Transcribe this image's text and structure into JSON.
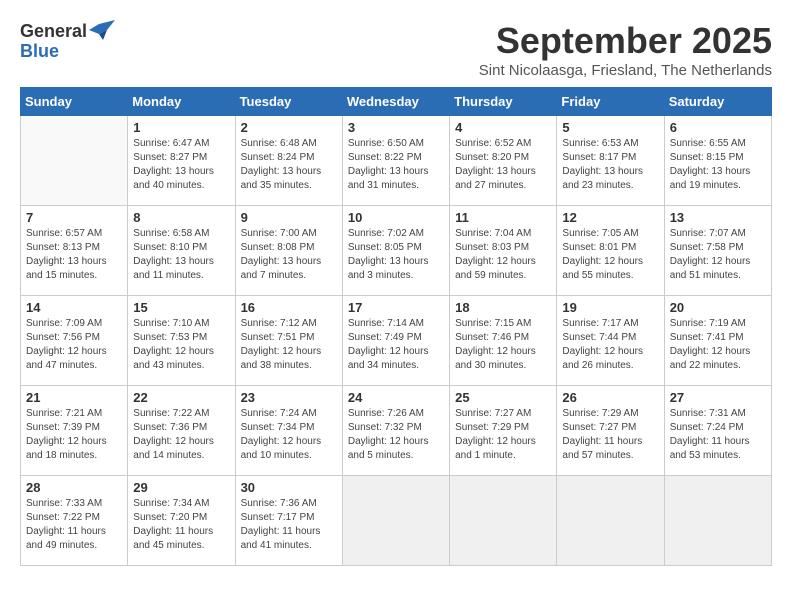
{
  "logo": {
    "general": "General",
    "blue": "Blue"
  },
  "title": "September 2025",
  "subtitle": "Sint Nicolaasga, Friesland, The Netherlands",
  "days_of_week": [
    "Sunday",
    "Monday",
    "Tuesday",
    "Wednesday",
    "Thursday",
    "Friday",
    "Saturday"
  ],
  "weeks": [
    [
      {
        "day": "",
        "info": ""
      },
      {
        "day": "1",
        "info": "Sunrise: 6:47 AM\nSunset: 8:27 PM\nDaylight: 13 hours and 40 minutes."
      },
      {
        "day": "2",
        "info": "Sunrise: 6:48 AM\nSunset: 8:24 PM\nDaylight: 13 hours and 35 minutes."
      },
      {
        "day": "3",
        "info": "Sunrise: 6:50 AM\nSunset: 8:22 PM\nDaylight: 13 hours and 31 minutes."
      },
      {
        "day": "4",
        "info": "Sunrise: 6:52 AM\nSunset: 8:20 PM\nDaylight: 13 hours and 27 minutes."
      },
      {
        "day": "5",
        "info": "Sunrise: 6:53 AM\nSunset: 8:17 PM\nDaylight: 13 hours and 23 minutes."
      },
      {
        "day": "6",
        "info": "Sunrise: 6:55 AM\nSunset: 8:15 PM\nDaylight: 13 hours and 19 minutes."
      }
    ],
    [
      {
        "day": "7",
        "info": "Sunrise: 6:57 AM\nSunset: 8:13 PM\nDaylight: 13 hours and 15 minutes."
      },
      {
        "day": "8",
        "info": "Sunrise: 6:58 AM\nSunset: 8:10 PM\nDaylight: 13 hours and 11 minutes."
      },
      {
        "day": "9",
        "info": "Sunrise: 7:00 AM\nSunset: 8:08 PM\nDaylight: 13 hours and 7 minutes."
      },
      {
        "day": "10",
        "info": "Sunrise: 7:02 AM\nSunset: 8:05 PM\nDaylight: 13 hours and 3 minutes."
      },
      {
        "day": "11",
        "info": "Sunrise: 7:04 AM\nSunset: 8:03 PM\nDaylight: 12 hours and 59 minutes."
      },
      {
        "day": "12",
        "info": "Sunrise: 7:05 AM\nSunset: 8:01 PM\nDaylight: 12 hours and 55 minutes."
      },
      {
        "day": "13",
        "info": "Sunrise: 7:07 AM\nSunset: 7:58 PM\nDaylight: 12 hours and 51 minutes."
      }
    ],
    [
      {
        "day": "14",
        "info": "Sunrise: 7:09 AM\nSunset: 7:56 PM\nDaylight: 12 hours and 47 minutes."
      },
      {
        "day": "15",
        "info": "Sunrise: 7:10 AM\nSunset: 7:53 PM\nDaylight: 12 hours and 43 minutes."
      },
      {
        "day": "16",
        "info": "Sunrise: 7:12 AM\nSunset: 7:51 PM\nDaylight: 12 hours and 38 minutes."
      },
      {
        "day": "17",
        "info": "Sunrise: 7:14 AM\nSunset: 7:49 PM\nDaylight: 12 hours and 34 minutes."
      },
      {
        "day": "18",
        "info": "Sunrise: 7:15 AM\nSunset: 7:46 PM\nDaylight: 12 hours and 30 minutes."
      },
      {
        "day": "19",
        "info": "Sunrise: 7:17 AM\nSunset: 7:44 PM\nDaylight: 12 hours and 26 minutes."
      },
      {
        "day": "20",
        "info": "Sunrise: 7:19 AM\nSunset: 7:41 PM\nDaylight: 12 hours and 22 minutes."
      }
    ],
    [
      {
        "day": "21",
        "info": "Sunrise: 7:21 AM\nSunset: 7:39 PM\nDaylight: 12 hours and 18 minutes."
      },
      {
        "day": "22",
        "info": "Sunrise: 7:22 AM\nSunset: 7:36 PM\nDaylight: 12 hours and 14 minutes."
      },
      {
        "day": "23",
        "info": "Sunrise: 7:24 AM\nSunset: 7:34 PM\nDaylight: 12 hours and 10 minutes."
      },
      {
        "day": "24",
        "info": "Sunrise: 7:26 AM\nSunset: 7:32 PM\nDaylight: 12 hours and 5 minutes."
      },
      {
        "day": "25",
        "info": "Sunrise: 7:27 AM\nSunset: 7:29 PM\nDaylight: 12 hours and 1 minute."
      },
      {
        "day": "26",
        "info": "Sunrise: 7:29 AM\nSunset: 7:27 PM\nDaylight: 11 hours and 57 minutes."
      },
      {
        "day": "27",
        "info": "Sunrise: 7:31 AM\nSunset: 7:24 PM\nDaylight: 11 hours and 53 minutes."
      }
    ],
    [
      {
        "day": "28",
        "info": "Sunrise: 7:33 AM\nSunset: 7:22 PM\nDaylight: 11 hours and 49 minutes."
      },
      {
        "day": "29",
        "info": "Sunrise: 7:34 AM\nSunset: 7:20 PM\nDaylight: 11 hours and 45 minutes."
      },
      {
        "day": "30",
        "info": "Sunrise: 7:36 AM\nSunset: 7:17 PM\nDaylight: 11 hours and 41 minutes."
      },
      {
        "day": "",
        "info": ""
      },
      {
        "day": "",
        "info": ""
      },
      {
        "day": "",
        "info": ""
      },
      {
        "day": "",
        "info": ""
      }
    ]
  ]
}
